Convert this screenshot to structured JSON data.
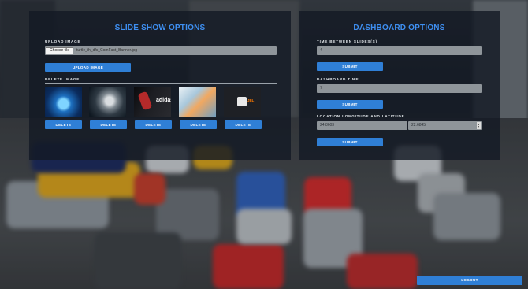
{
  "slideshow": {
    "title": "SLIDE SHOW OPTIONS",
    "upload_label": "UPLOAD IMAGE",
    "file_button": "Choose file",
    "file_name": "turtle_ih_dfc_ComFact_Banner.jpg",
    "upload_button": "UPLOAD IMAGE",
    "delete_label": "DELETE IMAGE",
    "thumbnails": [
      {
        "icon": "abstract-blue-image",
        "delete": "DELETE"
      },
      {
        "icon": "watch-image",
        "delete": "DELETE"
      },
      {
        "icon": "adidas-image",
        "delete": "DELETE",
        "logo": "adidas"
      },
      {
        "icon": "map-image",
        "delete": "DELETE"
      },
      {
        "icon": "jbl-speaker-image",
        "delete": "DELETE",
        "logo": "JBL"
      }
    ]
  },
  "dashboard": {
    "title": "DASHBOARD OPTIONS",
    "time_between_label": "TIME BETWEEN SLIDES(S)",
    "time_between_value": "4",
    "submit1": "SUBMIT",
    "dashboard_time_label": "DASHBOARD TIME",
    "dashboard_time_value": "7",
    "submit2": "SUBMIT",
    "location_label": "LOCATION LONGITUDE AND LATITUDE",
    "longitude": "24.8603",
    "latitude": "22.6845",
    "submit3": "SUBMIT"
  },
  "logout_button": "LOGOUT",
  "colors": {
    "accent": "#2f7fd6",
    "title": "#3e8ff1"
  }
}
